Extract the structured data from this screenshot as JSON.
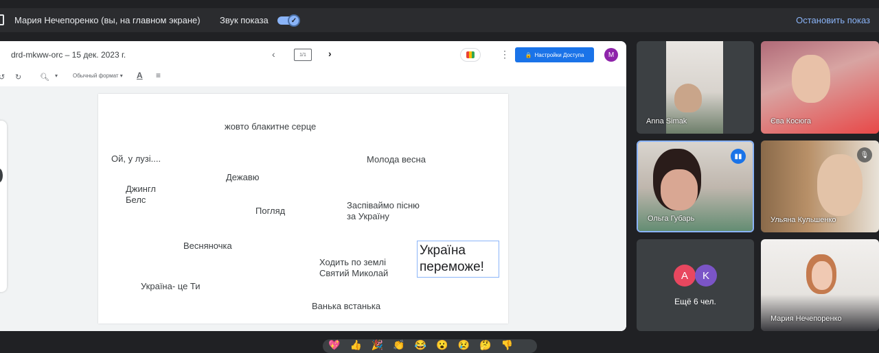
{
  "presenting_bar": {
    "presenter_label": "Мария Нечепоренко (вы, на главном экране)",
    "sound_label": "Звук показа",
    "sound_enabled": true,
    "stop_label": "Остановить показ"
  },
  "document": {
    "title": "drd-mkww-orc – 15 дек. 2023 г.",
    "slide_counter": "1/1",
    "access_button": "Настройки Доступа",
    "account_initial": "M",
    "format_select": "Обычный формат"
  },
  "slide": {
    "words": [
      "жовто блакитне серце",
      "Ой, у лузі....",
      "Молода весна",
      "Дежавю",
      "Джингл\nБелс",
      "Погляд",
      "Заспіваймо пісню\nза Україну",
      "Весняночка",
      "Ходить по землі\nСвятий Миколай",
      "Україна- це Ти",
      "Ванька встанька",
      "Україна переможе!"
    ]
  },
  "participants": [
    {
      "name": "Anna Simak"
    },
    {
      "name": "Єва Косюга"
    },
    {
      "name": "Ольга Губарь",
      "speaking": true
    },
    {
      "name": "Ульяна Кульшенко",
      "muted": true
    },
    {
      "more_label": "Ещё 6 чел.",
      "avatars": [
        {
          "letter": "A",
          "color": "#e8475f"
        },
        {
          "letter": "K",
          "color": "#7b55c7"
        }
      ]
    },
    {
      "name": "Мария Нечепоренко"
    }
  ],
  "reactions": [
    "💖",
    "👍",
    "🎉",
    "👏",
    "😂",
    "😮",
    "😢",
    "🤔",
    "👎"
  ],
  "colors": {
    "meet_bg": "#202124",
    "accent": "#8ab4f8",
    "docs_blue": "#1a73e8"
  }
}
